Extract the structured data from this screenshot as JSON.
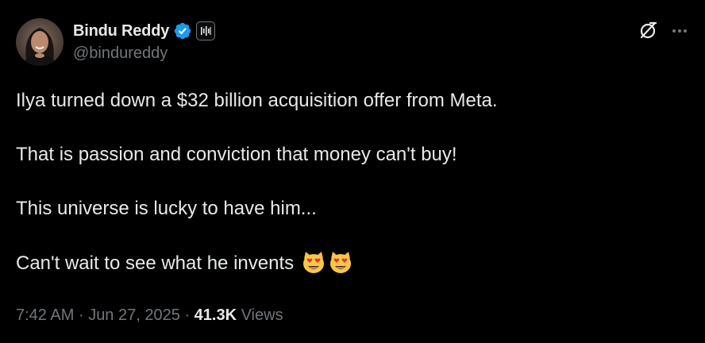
{
  "author": {
    "display_name": "Bindu Reddy",
    "handle": "@bindureddy",
    "verified": true,
    "verified_color": "#1d9bf0",
    "affiliate_badge": "affiliate-logo-icon",
    "avatar": "profile-photo"
  },
  "header_actions": {
    "grok_icon": "grok-icon",
    "more_icon": "more-options-icon"
  },
  "tweet": {
    "paragraphs": [
      "Ilya turned down a $32 billion acquisition offer from Meta.",
      "That is passion and conviction that money can't buy!",
      "This universe is lucky to have him...",
      "Can't wait to see what he invents"
    ],
    "trailing_emoji": "heart-eyes-cat-emoji x2"
  },
  "meta": {
    "time": "7:42 AM",
    "separator": "·",
    "date": "Jun 27, 2025",
    "views_count": "41.3K",
    "views_label": "Views"
  },
  "colors": {
    "background": "#000000",
    "primary_text": "#e7e9ea",
    "secondary_text": "#71767b",
    "accent": "#1d9bf0"
  }
}
